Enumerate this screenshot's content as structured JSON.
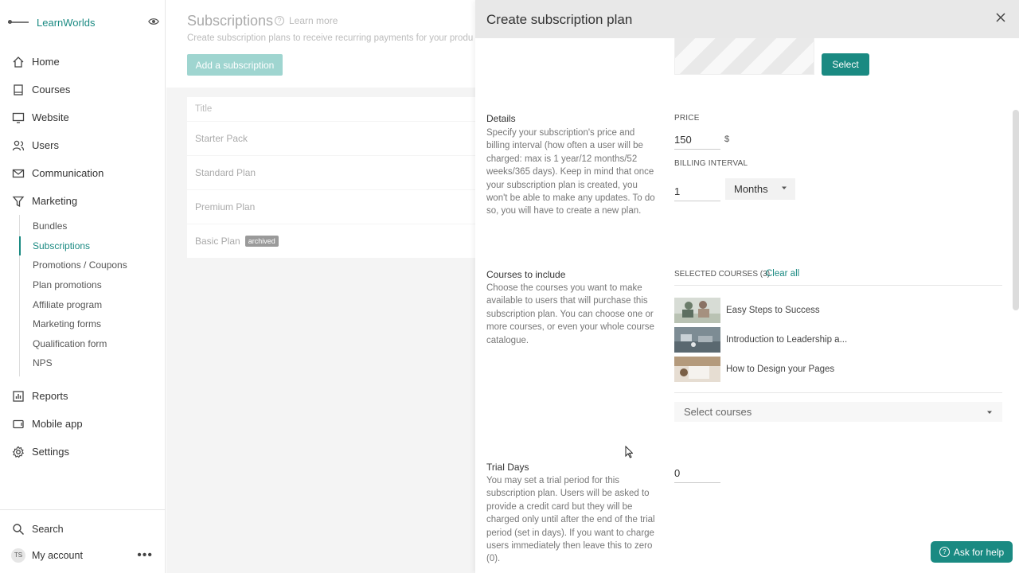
{
  "brand": {
    "name": "LearnWorlds"
  },
  "sidebar": {
    "items": [
      {
        "label": "Home",
        "icon": "home-icon"
      },
      {
        "label": "Courses",
        "icon": "book-icon"
      },
      {
        "label": "Website",
        "icon": "monitor-icon"
      },
      {
        "label": "Users",
        "icon": "users-icon"
      },
      {
        "label": "Communication",
        "icon": "mail-icon"
      },
      {
        "label": "Marketing",
        "icon": "funnel-icon"
      }
    ],
    "marketing_sub": [
      "Bundles",
      "Subscriptions",
      "Promotions / Coupons",
      "Plan promotions",
      "Affiliate program",
      "Marketing forms",
      "Qualification form",
      "NPS"
    ],
    "lower_items": [
      {
        "label": "Reports",
        "icon": "chart-icon"
      },
      {
        "label": "Mobile app",
        "icon": "phone-icon"
      },
      {
        "label": "Settings",
        "icon": "gear-icon"
      }
    ],
    "search_label": "Search",
    "account_label": "My account",
    "account_initials": "TS"
  },
  "main": {
    "title": "Subscriptions",
    "learn_more": "Learn more",
    "subtitle": "Create subscription plans to receive recurring payments for your produ",
    "add_button": "Add a subscription",
    "list_header": "Title",
    "rows": [
      "Starter Pack",
      "Standard Plan",
      "Premium Plan",
      "Basic Plan"
    ],
    "archived_badge": "archived"
  },
  "drawer": {
    "title": "Create subscription plan",
    "select_button": "Select",
    "details": {
      "title": "Details",
      "description": "Specify your subscription's price and billing interval (how often a user will be charged: max is 1 year/12 months/52 weeks/365 days). Keep in mind that once your subscription plan is created, you won't be able to make any updates. To do so, you will have to create a new plan."
    },
    "price_label": "PRICE",
    "price_value": "150",
    "currency": "$",
    "billing_label": "BILLING INTERVAL",
    "billing_value": "1",
    "billing_unit": "Months",
    "courses": {
      "title": "Courses to include",
      "description": "Choose the courses you want to make available to users that will purchase this subscription plan. You can choose one or more courses, or even your whole course catalogue.",
      "selected_label": "SELECTED COURSES (3)",
      "clear_all": "Clear all",
      "items": [
        "Easy Steps to Success",
        "Introduction to Leadership a...",
        "How to Design your Pages"
      ],
      "select_placeholder": "Select courses"
    },
    "trial": {
      "title": "Trial Days",
      "description": "You may set a trial period for this subscription plan. Users will be asked to provide a credit card but they will be charged only until after the end of the trial period (set in days). If you want to charge users immediately then leave this to zero (0).",
      "value": "0"
    }
  },
  "help_button": "Ask for help",
  "colors": {
    "accent": "#1a8a82",
    "accent_disabled": "#9fd5d0"
  }
}
